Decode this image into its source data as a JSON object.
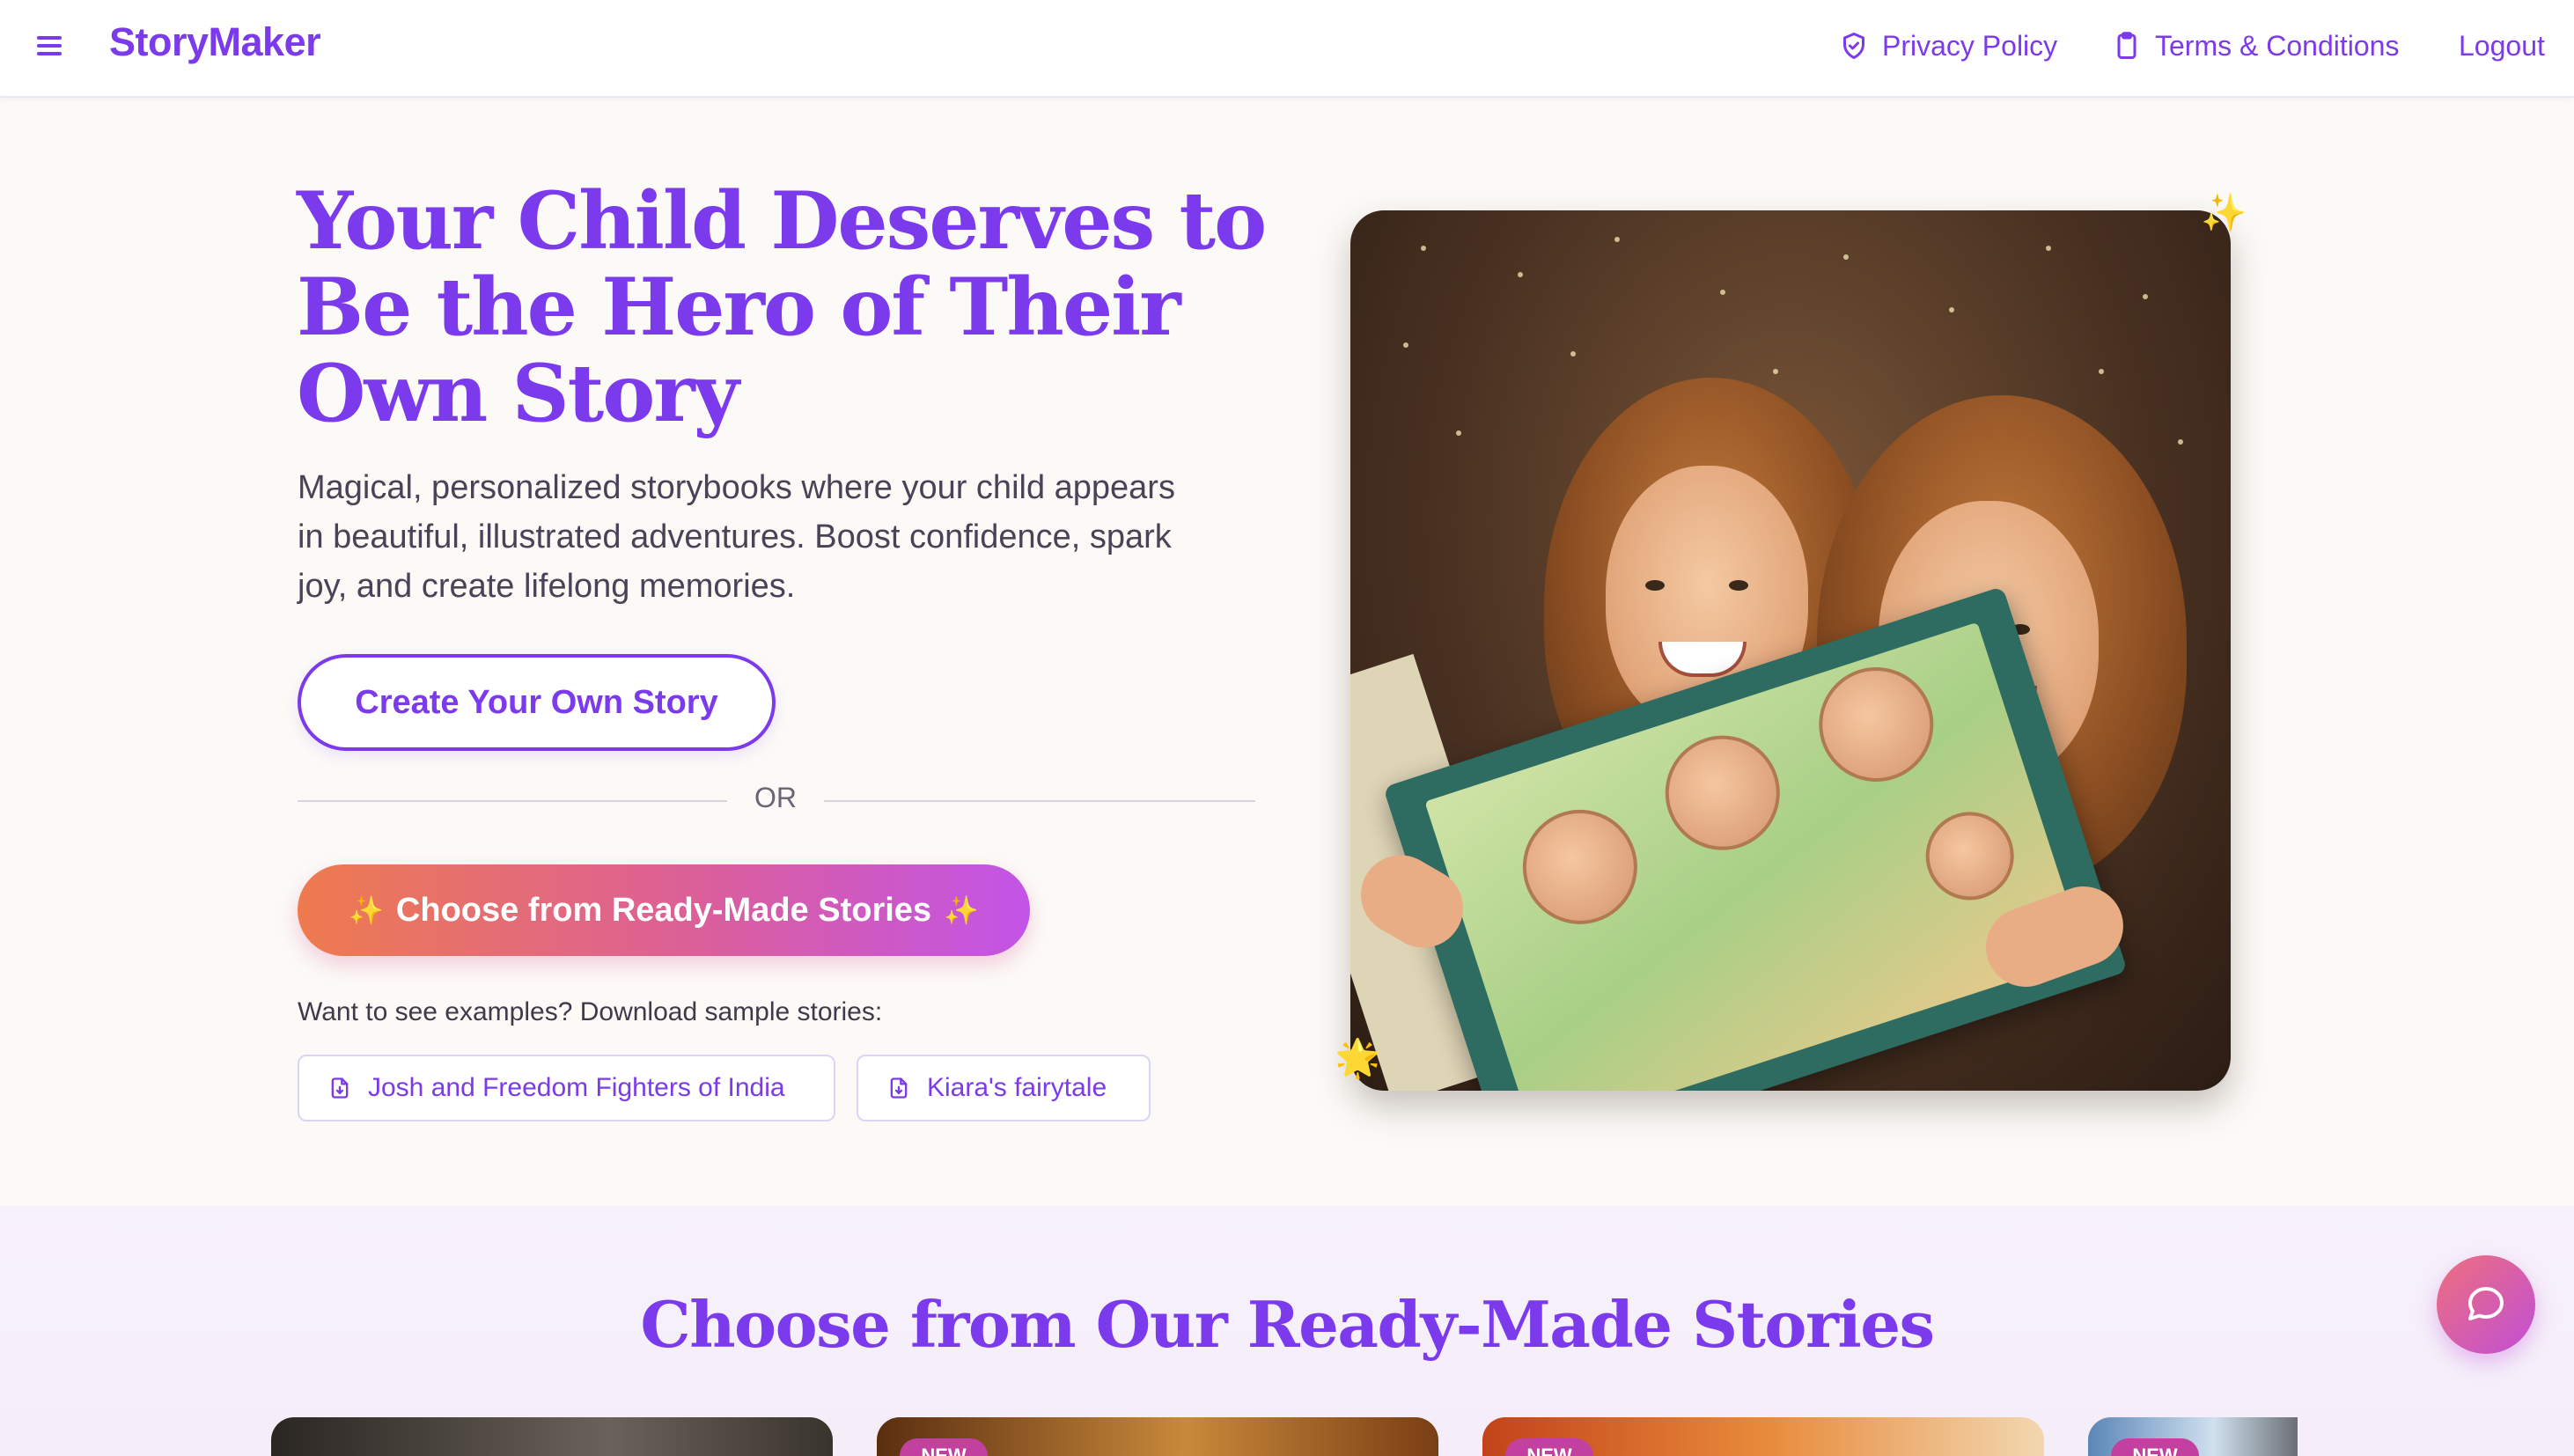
{
  "nav": {
    "brand": "StoryMaker",
    "privacy_label": "Privacy Policy",
    "terms_label": "Terms & Conditions",
    "logout_label": "Logout"
  },
  "hero": {
    "title": "Your Child Deserves to Be the Hero of Their Own Story",
    "subtitle": "Magical, personalized storybooks where your child appears in beautiful, illustrated adventures. Boost confidence, spark joy, and create lifelong memories.",
    "create_button": "Create Your Own Story",
    "or_text": "OR",
    "choose_button": "Choose from Ready-Made Stories",
    "sample_label": "Want to see examples? Download sample stories:",
    "samples": [
      {
        "label": "Josh and Freedom Fighters of India"
      },
      {
        "label": "Kiara's fairytale"
      }
    ]
  },
  "section": {
    "title": "Choose from Our Ready-Made Stories",
    "badge": "NEW"
  },
  "colors": {
    "accent": "#7c3aed",
    "gradient_start": "#ee7b4e",
    "gradient_end": "#c254e8"
  },
  "icons": [
    "menu-icon",
    "shield-icon",
    "clipboard-icon",
    "file-download-icon",
    "sparkle-icon",
    "chat-icon"
  ]
}
